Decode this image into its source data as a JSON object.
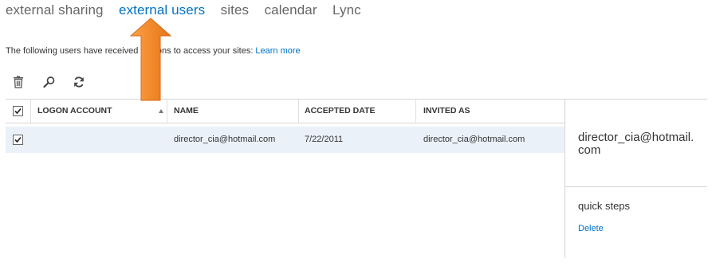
{
  "tabs": [
    {
      "label": "external sharing"
    },
    {
      "label": "external users"
    },
    {
      "label": "sites"
    },
    {
      "label": "calendar"
    },
    {
      "label": "Lync"
    }
  ],
  "intro": {
    "text_before": "The following users have received",
    "text_after": "ations to access your sites:",
    "link": "Learn more"
  },
  "toolbar": {
    "icons": [
      "trash-icon",
      "search-icon",
      "refresh-icon"
    ]
  },
  "grid": {
    "columns": [
      "LOGON ACCOUNT",
      "NAME",
      "ACCEPTED DATE",
      "INVITED AS"
    ],
    "sorted_column": "LOGON ACCOUNT",
    "sort_direction": "ascending",
    "header_checked": true,
    "rows": [
      {
        "checked": true,
        "logon_account": "",
        "name": "director_cia@hotmail.com",
        "accepted_date": "7/22/2011",
        "invited_as": "director_cia@hotmail.com"
      }
    ]
  },
  "detail": {
    "email": "director_cia@hotmail.com",
    "quick_steps": "quick steps",
    "delete": "Delete"
  },
  "colors": {
    "accent": "#0072c6",
    "selected_row": "#eaf1f8",
    "annotation_arrow": "#f28a2c"
  }
}
